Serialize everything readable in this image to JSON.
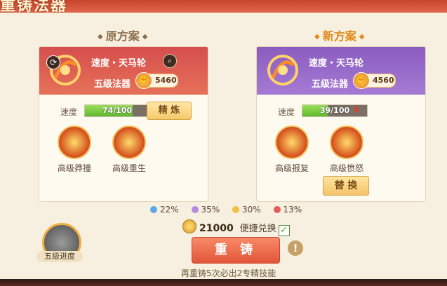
{
  "header": {
    "title": "重铸法器"
  },
  "old_plan": {
    "section_title": "原方案",
    "item_name": "速度・天马轮",
    "grade": "五级法器",
    "power": "5460",
    "speed_label": "速度",
    "speed_text": "74/100",
    "speed_value": 74,
    "refine_label": "精 炼",
    "skills": [
      {
        "label": "高级莽撞"
      },
      {
        "label": "高级重生"
      }
    ]
  },
  "new_plan": {
    "section_title": "新方案",
    "item_name": "速度・天马轮",
    "grade": "五级法器",
    "power": "4560",
    "speed_label": "速度",
    "speed_text": "39/100",
    "speed_value": 39,
    "skills": [
      {
        "label": "高级报复"
      },
      {
        "label": "高级愤怒"
      }
    ],
    "replace_label": "替 换"
  },
  "odds": [
    {
      "text": "22%",
      "color": "#5aa8e8"
    },
    {
      "text": "35%",
      "color": "#b68ae0"
    },
    {
      "text": "30%",
      "color": "#f0c040"
    },
    {
      "text": "13%",
      "color": "#e85a5a"
    }
  ],
  "cost": {
    "amount": "21000",
    "quick_label": "便捷兑换",
    "quick_checked": true
  },
  "reforge_label": "重 铸",
  "tip": "再重铸5次必出2专精技能",
  "progress_label": "五级进度"
}
